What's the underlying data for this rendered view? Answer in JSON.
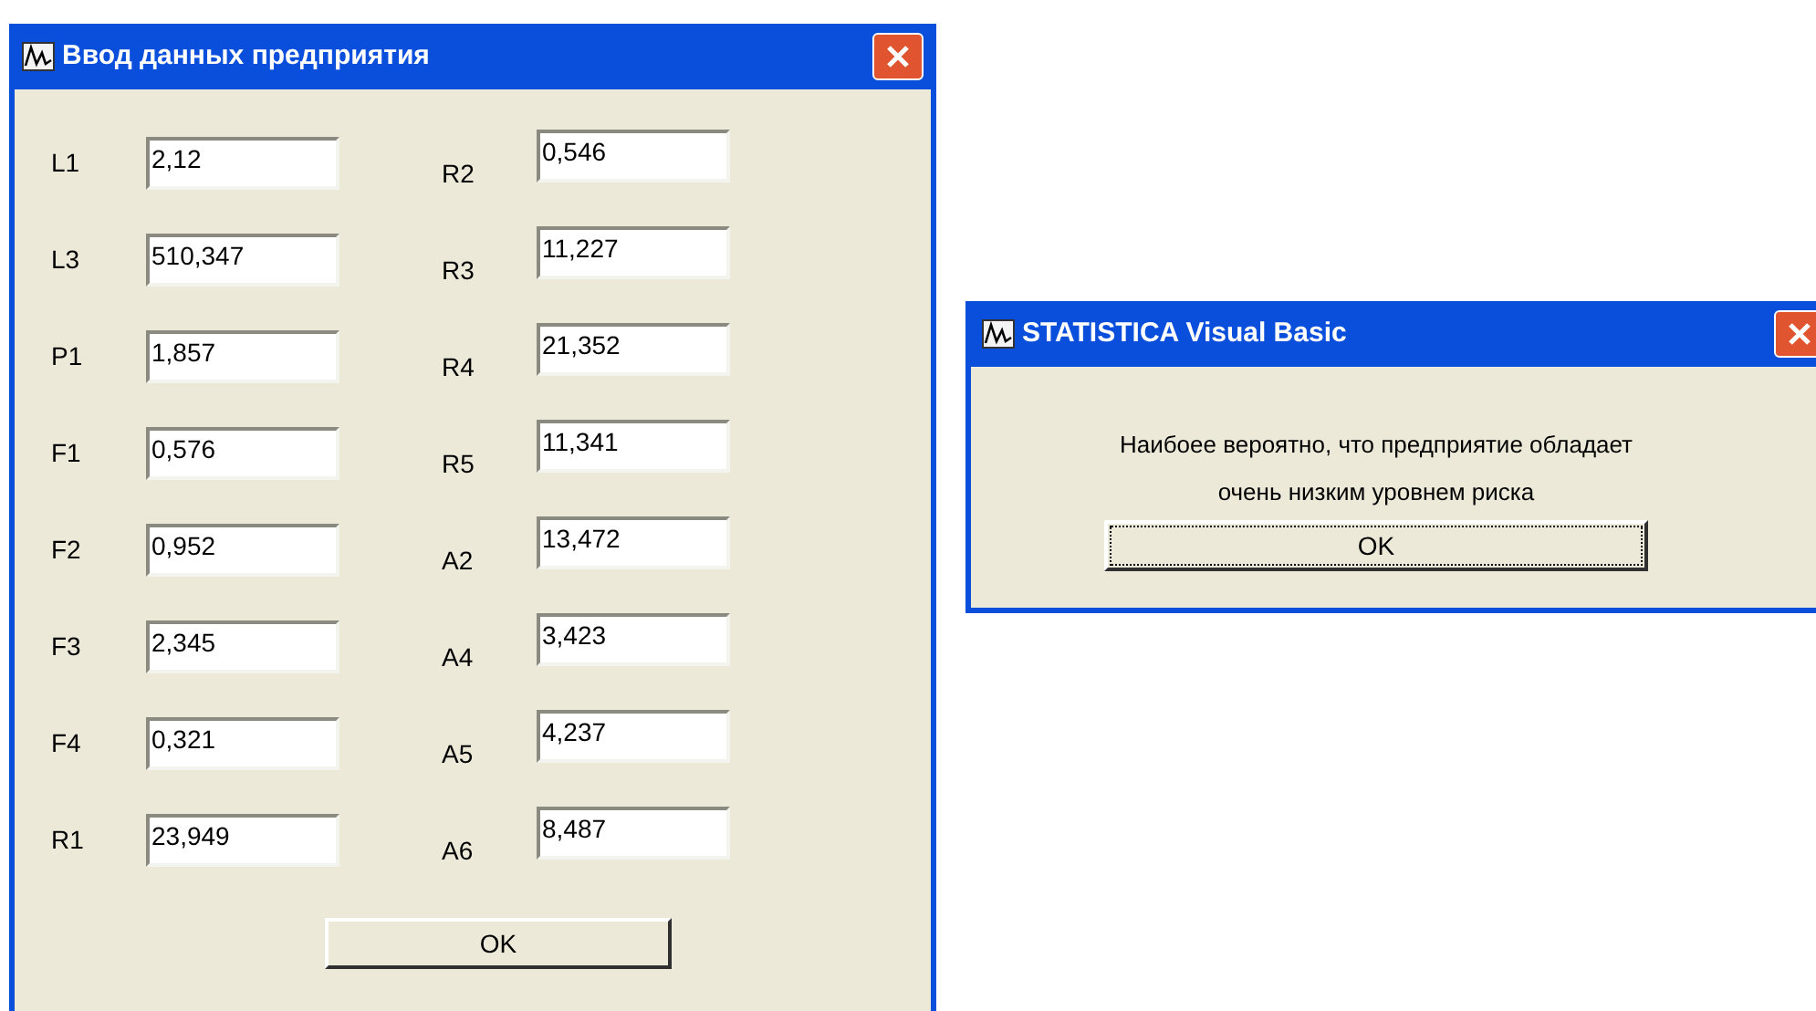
{
  "input_window": {
    "title": "Ввод данных предприятия",
    "left_fields": [
      {
        "label": "L1",
        "value": "2,12"
      },
      {
        "label": "L3",
        "value": "510,347"
      },
      {
        "label": "P1",
        "value": "1,857"
      },
      {
        "label": "F1",
        "value": "0,576"
      },
      {
        "label": "F2",
        "value": "0,952"
      },
      {
        "label": "F3",
        "value": "2,345"
      },
      {
        "label": "F4",
        "value": "0,321"
      },
      {
        "label": "R1",
        "value": "23,949"
      }
    ],
    "right_fields": [
      {
        "label": "R2",
        "value": "0,546"
      },
      {
        "label": "R3",
        "value": "11,227"
      },
      {
        "label": "R4",
        "value": "21,352"
      },
      {
        "label": "R5",
        "value": "11,341"
      },
      {
        "label": "A2",
        "value": "13,472"
      },
      {
        "label": "A4",
        "value": "3,423"
      },
      {
        "label": "A5",
        "value": "4,237"
      },
      {
        "label": "A6",
        "value": "8,487"
      }
    ],
    "button": "OK"
  },
  "message_window": {
    "title": "STATISTICA Visual Basic",
    "message_lines": [
      "Наибоее вероятно, что предприятие обладает",
      "очень низким уровнем риска"
    ],
    "button": "OK"
  }
}
